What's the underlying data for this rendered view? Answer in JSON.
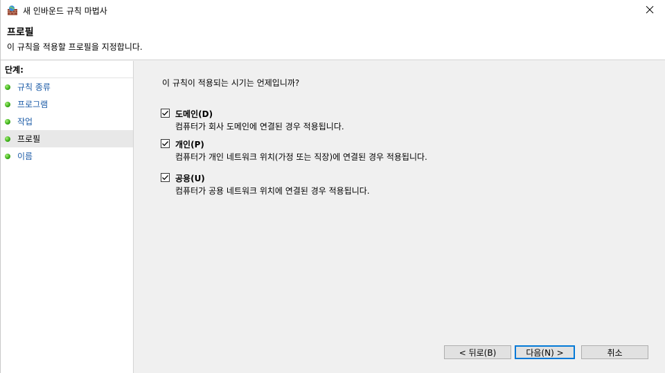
{
  "window": {
    "title": "새 인바운드 규칙 마법사",
    "close_icon": "close-icon"
  },
  "header": {
    "title": "프로필",
    "description": "이 규칙을 적용할 프로필을 지정합니다."
  },
  "sidebar": {
    "steps_label": "단계:",
    "items": [
      {
        "label": "규칙 종류",
        "active": false
      },
      {
        "label": "프로그램",
        "active": false
      },
      {
        "label": "작업",
        "active": false
      },
      {
        "label": "프로필",
        "active": true
      },
      {
        "label": "이름",
        "active": false
      }
    ]
  },
  "main": {
    "question": "이 규칙이 적용되는 시기는 언제입니까?",
    "options": [
      {
        "label": "도메인(D)",
        "description": "컴퓨터가 회사 도메인에 연결된 경우 적용됩니다.",
        "checked": true
      },
      {
        "label": "개인(P)",
        "description": "컴퓨터가 개인 네트워크 위치(가정 또는 직장)에 연결된 경우 적용됩니다.",
        "checked": true
      },
      {
        "label": "공용(U)",
        "description": "컴퓨터가 공용 네트워크 위치에 연결된 경우 적용됩니다.",
        "checked": true
      }
    ]
  },
  "buttons": {
    "back": "< 뒤로(B)",
    "next": "다음(N) >",
    "cancel": "취소"
  },
  "colors": {
    "accent": "#0078d7",
    "link": "#1a5aa6",
    "status_dot": "#3fb21a"
  }
}
